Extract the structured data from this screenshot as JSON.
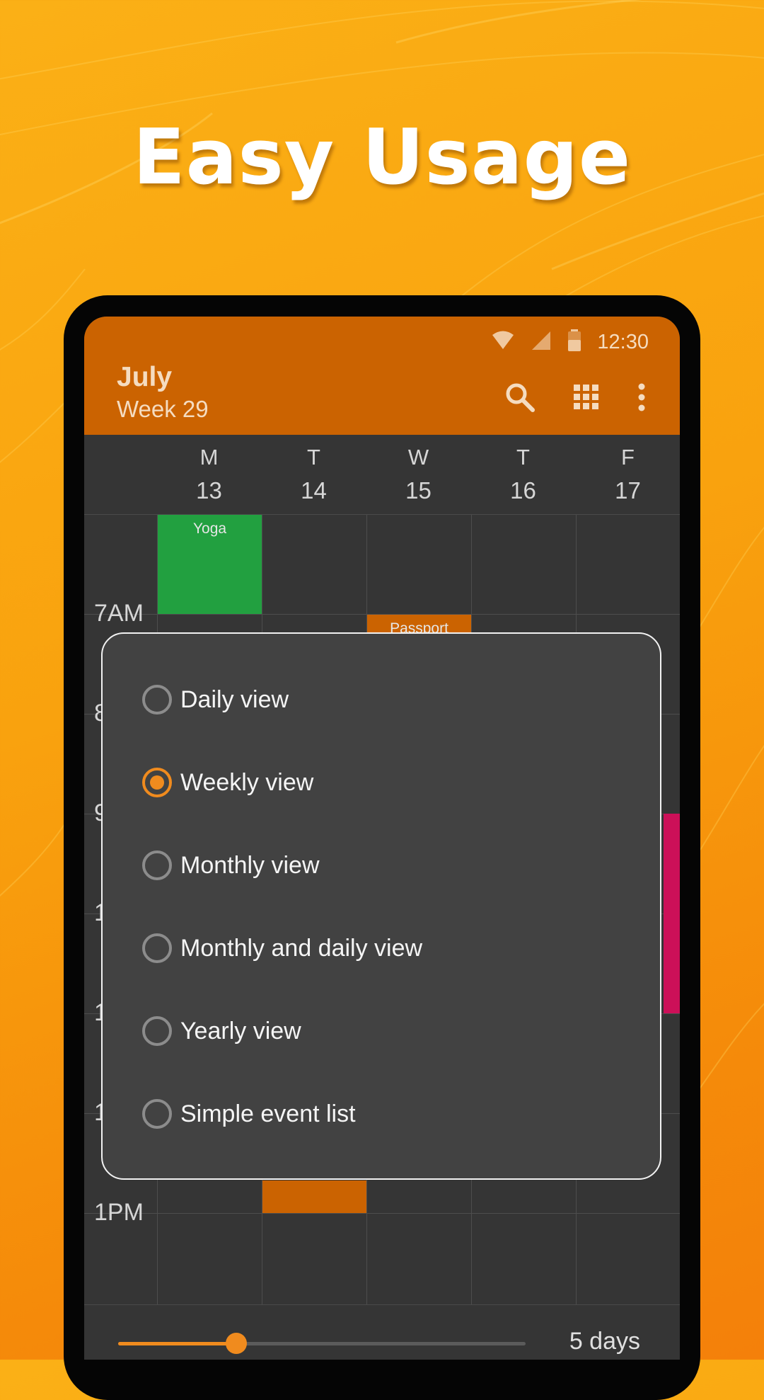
{
  "headline": "Easy Usage",
  "status_bar": {
    "time": "12:30",
    "icons": [
      "wifi-icon",
      "signal-icon",
      "battery-icon"
    ]
  },
  "app_bar": {
    "month": "July",
    "week": "Week 29",
    "actions": [
      "search-icon",
      "grid-icon",
      "more-vert-icon"
    ]
  },
  "days": [
    {
      "letter": "M",
      "num": "13"
    },
    {
      "letter": "T",
      "num": "14"
    },
    {
      "letter": "W",
      "num": "15"
    },
    {
      "letter": "T",
      "num": "16"
    },
    {
      "letter": "F",
      "num": "17"
    }
  ],
  "time_labels": {
    "t7": "7AM",
    "t8": "8",
    "t9": "9",
    "t10": "1",
    "t11": "1",
    "t12": "1",
    "t13": "1PM"
  },
  "events": [
    {
      "title": "Yoga",
      "color": "#22a040"
    },
    {
      "title": "Passport",
      "color": "#cb6301"
    },
    {
      "title": "",
      "color": "#cc1058"
    },
    {
      "title": "",
      "color": "#cb6301"
    }
  ],
  "view_dialog": {
    "options": [
      {
        "label": "Daily view",
        "checked": false
      },
      {
        "label": "Weekly view",
        "checked": true
      },
      {
        "label": "Monthly view",
        "checked": false
      },
      {
        "label": "Monthly and daily view",
        "checked": false
      },
      {
        "label": "Yearly view",
        "checked": false
      },
      {
        "label": "Simple event list",
        "checked": false
      }
    ]
  },
  "slider": {
    "value_label": "5 days",
    "fraction": 0.29
  },
  "colors": {
    "accent": "#f08b1e",
    "app_bar": "#cb6301",
    "background": "#353535",
    "dialog": "#424242"
  }
}
